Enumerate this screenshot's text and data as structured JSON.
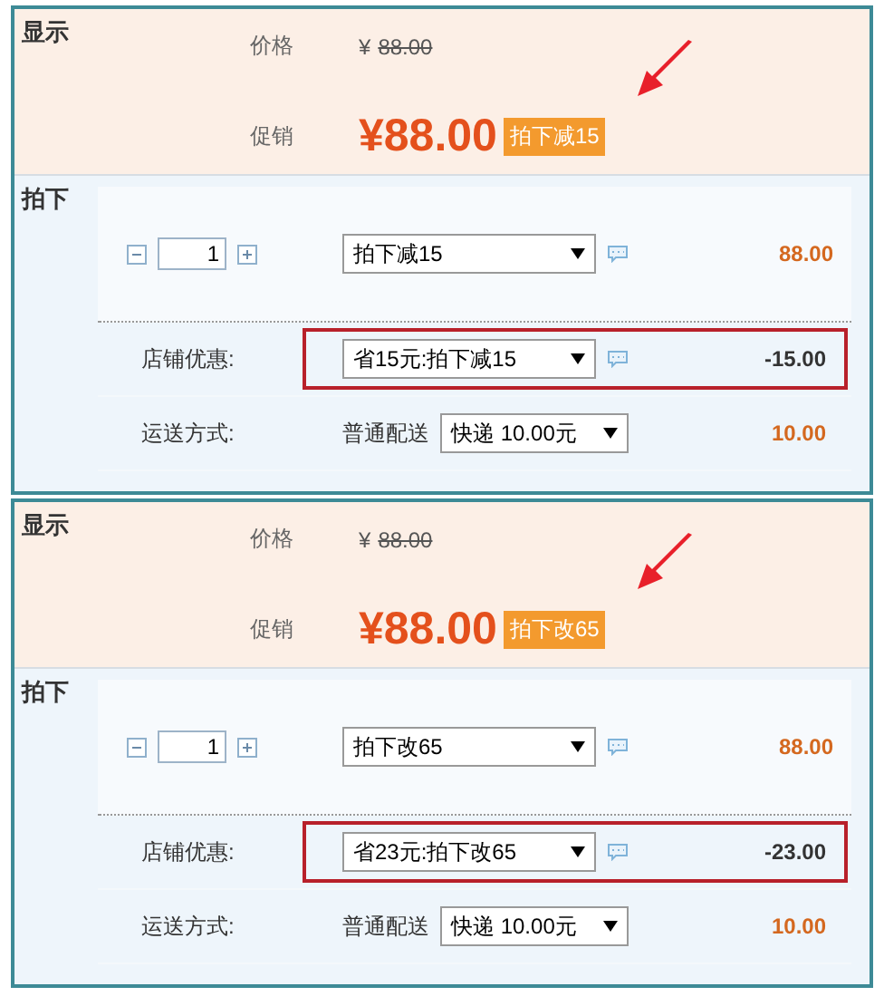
{
  "panels": [
    {
      "display": {
        "label": "显示",
        "price_label": "价格",
        "currency": "¥",
        "original_price": "88.00",
        "promo_label": "促销",
        "promo_price": "¥88.00",
        "badge": "拍下减15"
      },
      "buy": {
        "label": "拍下",
        "quantity": "1",
        "plan_select": "拍下减15",
        "price": "88.00",
        "discount_label": "店铺优惠:",
        "discount_select": "省15元:拍下减15",
        "discount_amount": "-15.00",
        "discount_highlighted": true,
        "shipping_label": "运送方式:",
        "shipping_option": "普通配送",
        "shipping_select": "快递 10.00元",
        "shipping_price": "10.00"
      }
    },
    {
      "display": {
        "label": "显示",
        "price_label": "价格",
        "currency": "¥",
        "original_price": "88.00",
        "promo_label": "促销",
        "promo_price": "¥88.00",
        "badge": "拍下改65"
      },
      "buy": {
        "label": "拍下",
        "quantity": "1",
        "plan_select": "拍下改65",
        "price": "88.00",
        "discount_label": "店铺优惠:",
        "discount_select": "省23元:拍下改65",
        "discount_amount": "-23.00",
        "discount_highlighted": true,
        "shipping_label": "运送方式:",
        "shipping_option": "普通配送",
        "shipping_select": "快递 10.00元",
        "shipping_price": "10.00"
      }
    }
  ]
}
